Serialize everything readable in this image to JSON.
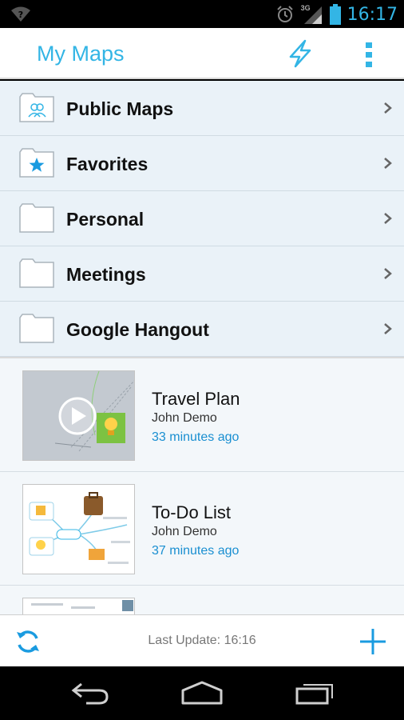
{
  "status_bar": {
    "time": "16:17",
    "network": "3G",
    "icons": [
      "wifi-question-icon",
      "alarm-icon",
      "signal-icon",
      "battery-icon"
    ]
  },
  "action_bar": {
    "title": "My Maps",
    "actions": [
      "lightning-icon",
      "overflow-menu-icon"
    ]
  },
  "folders": [
    {
      "label": "Public Maps",
      "icon": "public-folder-icon"
    },
    {
      "label": "Favorites",
      "icon": "favorites-folder-icon"
    },
    {
      "label": "Personal",
      "icon": "folder-icon"
    },
    {
      "label": "Meetings",
      "icon": "folder-icon"
    },
    {
      "label": "Google Hangout",
      "icon": "folder-icon"
    }
  ],
  "maps": [
    {
      "name": "Travel Plan",
      "author": "John Demo",
      "updated": "33 minutes ago"
    },
    {
      "name": "To-Do List",
      "author": "John Demo",
      "updated": "37 minutes ago"
    }
  ],
  "bottom_bar": {
    "last_update": "Last Update: 16:16"
  },
  "colors": {
    "accent": "#33b5e5",
    "list_bg": "#eaf2f8",
    "time_blue": "#1a8fd1"
  }
}
